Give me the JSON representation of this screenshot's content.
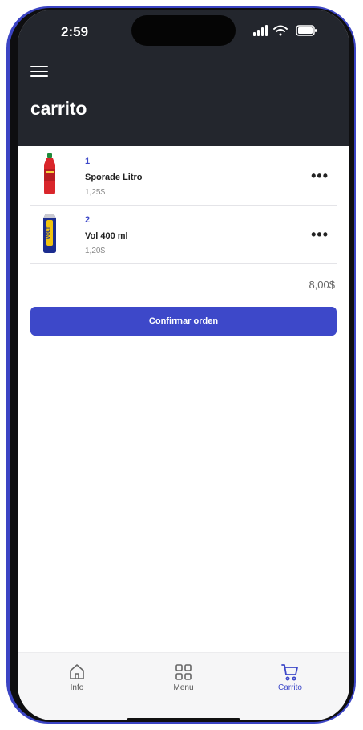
{
  "status_bar": {
    "time": "2:59",
    "icons": [
      "signal-icon",
      "wifi-icon",
      "battery-icon"
    ]
  },
  "header": {
    "menu_icon": "hamburger-menu-icon",
    "title": "carrito"
  },
  "cart": {
    "items": [
      {
        "quantity": "1",
        "name": "Sporade Litro",
        "price": "1,25$",
        "image": "red-bottle"
      },
      {
        "quantity": "2",
        "name": "Vol 400 ml",
        "price": "1,20$",
        "image": "volt-can",
        "brand": "VOLT"
      }
    ],
    "total": "8,00$",
    "confirm_label": "Confirmar orden"
  },
  "tabbar": {
    "tabs": [
      {
        "label": "Info",
        "icon": "home-icon",
        "active": false
      },
      {
        "label": "Menu",
        "icon": "grid-icon",
        "active": false
      },
      {
        "label": "Carrito",
        "icon": "cart-icon",
        "active": true
      }
    ]
  },
  "colors": {
    "header_bg": "#23262d",
    "accent": "#3d48c9",
    "frame": "#3b44c4"
  }
}
